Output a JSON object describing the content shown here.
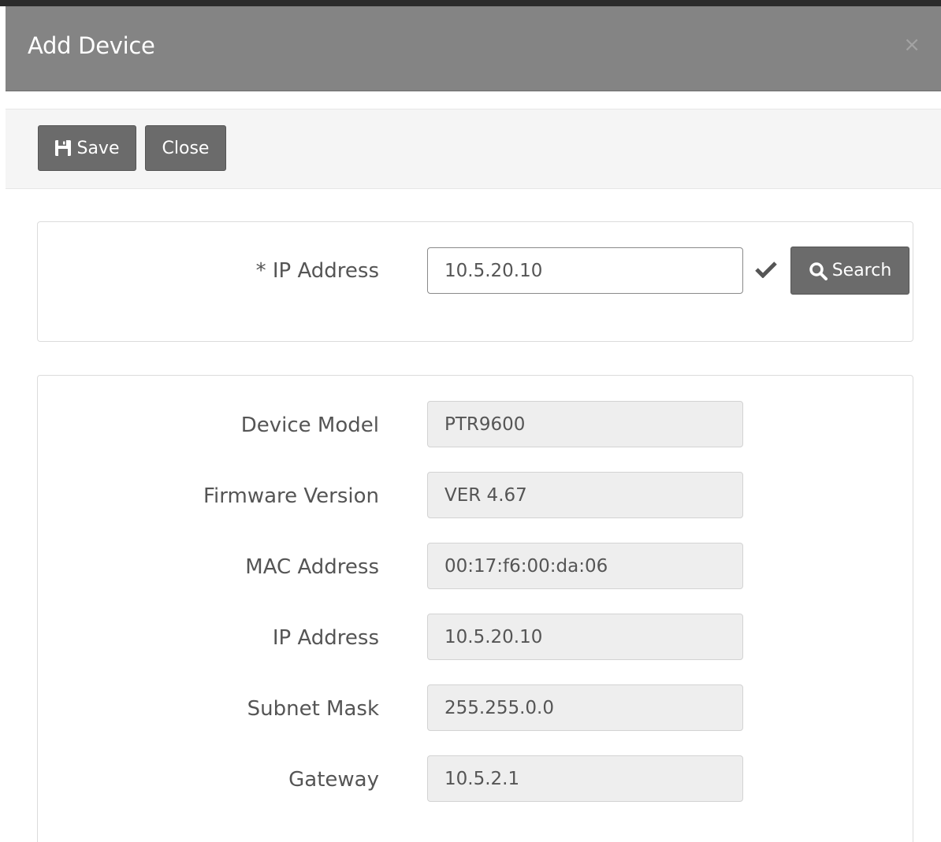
{
  "modal": {
    "title": "Add Device",
    "close_glyph": "×"
  },
  "toolbar": {
    "save_label": "Save",
    "close_label": "Close"
  },
  "lookup": {
    "ip_label": "* IP Address",
    "ip_value": "10.5.20.10",
    "search_label": "Search"
  },
  "details": {
    "fields": [
      {
        "label": "Device Model",
        "value": "PTR9600"
      },
      {
        "label": "Firmware Version",
        "value": "VER 4.67"
      },
      {
        "label": "MAC Address",
        "value": "00:17:f6:00:da:06"
      },
      {
        "label": "IP Address",
        "value": "10.5.20.10"
      },
      {
        "label": "Subnet Mask",
        "value": "255.255.0.0"
      },
      {
        "label": "Gateway",
        "value": "10.5.2.1"
      }
    ]
  },
  "icons": {
    "save": "floppy-disk-icon",
    "search": "magnifier-icon",
    "valid": "checkmark-icon",
    "close": "close-icon"
  },
  "colors": {
    "header_bg": "#848484",
    "button_bg": "#6b6b6b",
    "readonly_bg": "#eeeeee"
  }
}
